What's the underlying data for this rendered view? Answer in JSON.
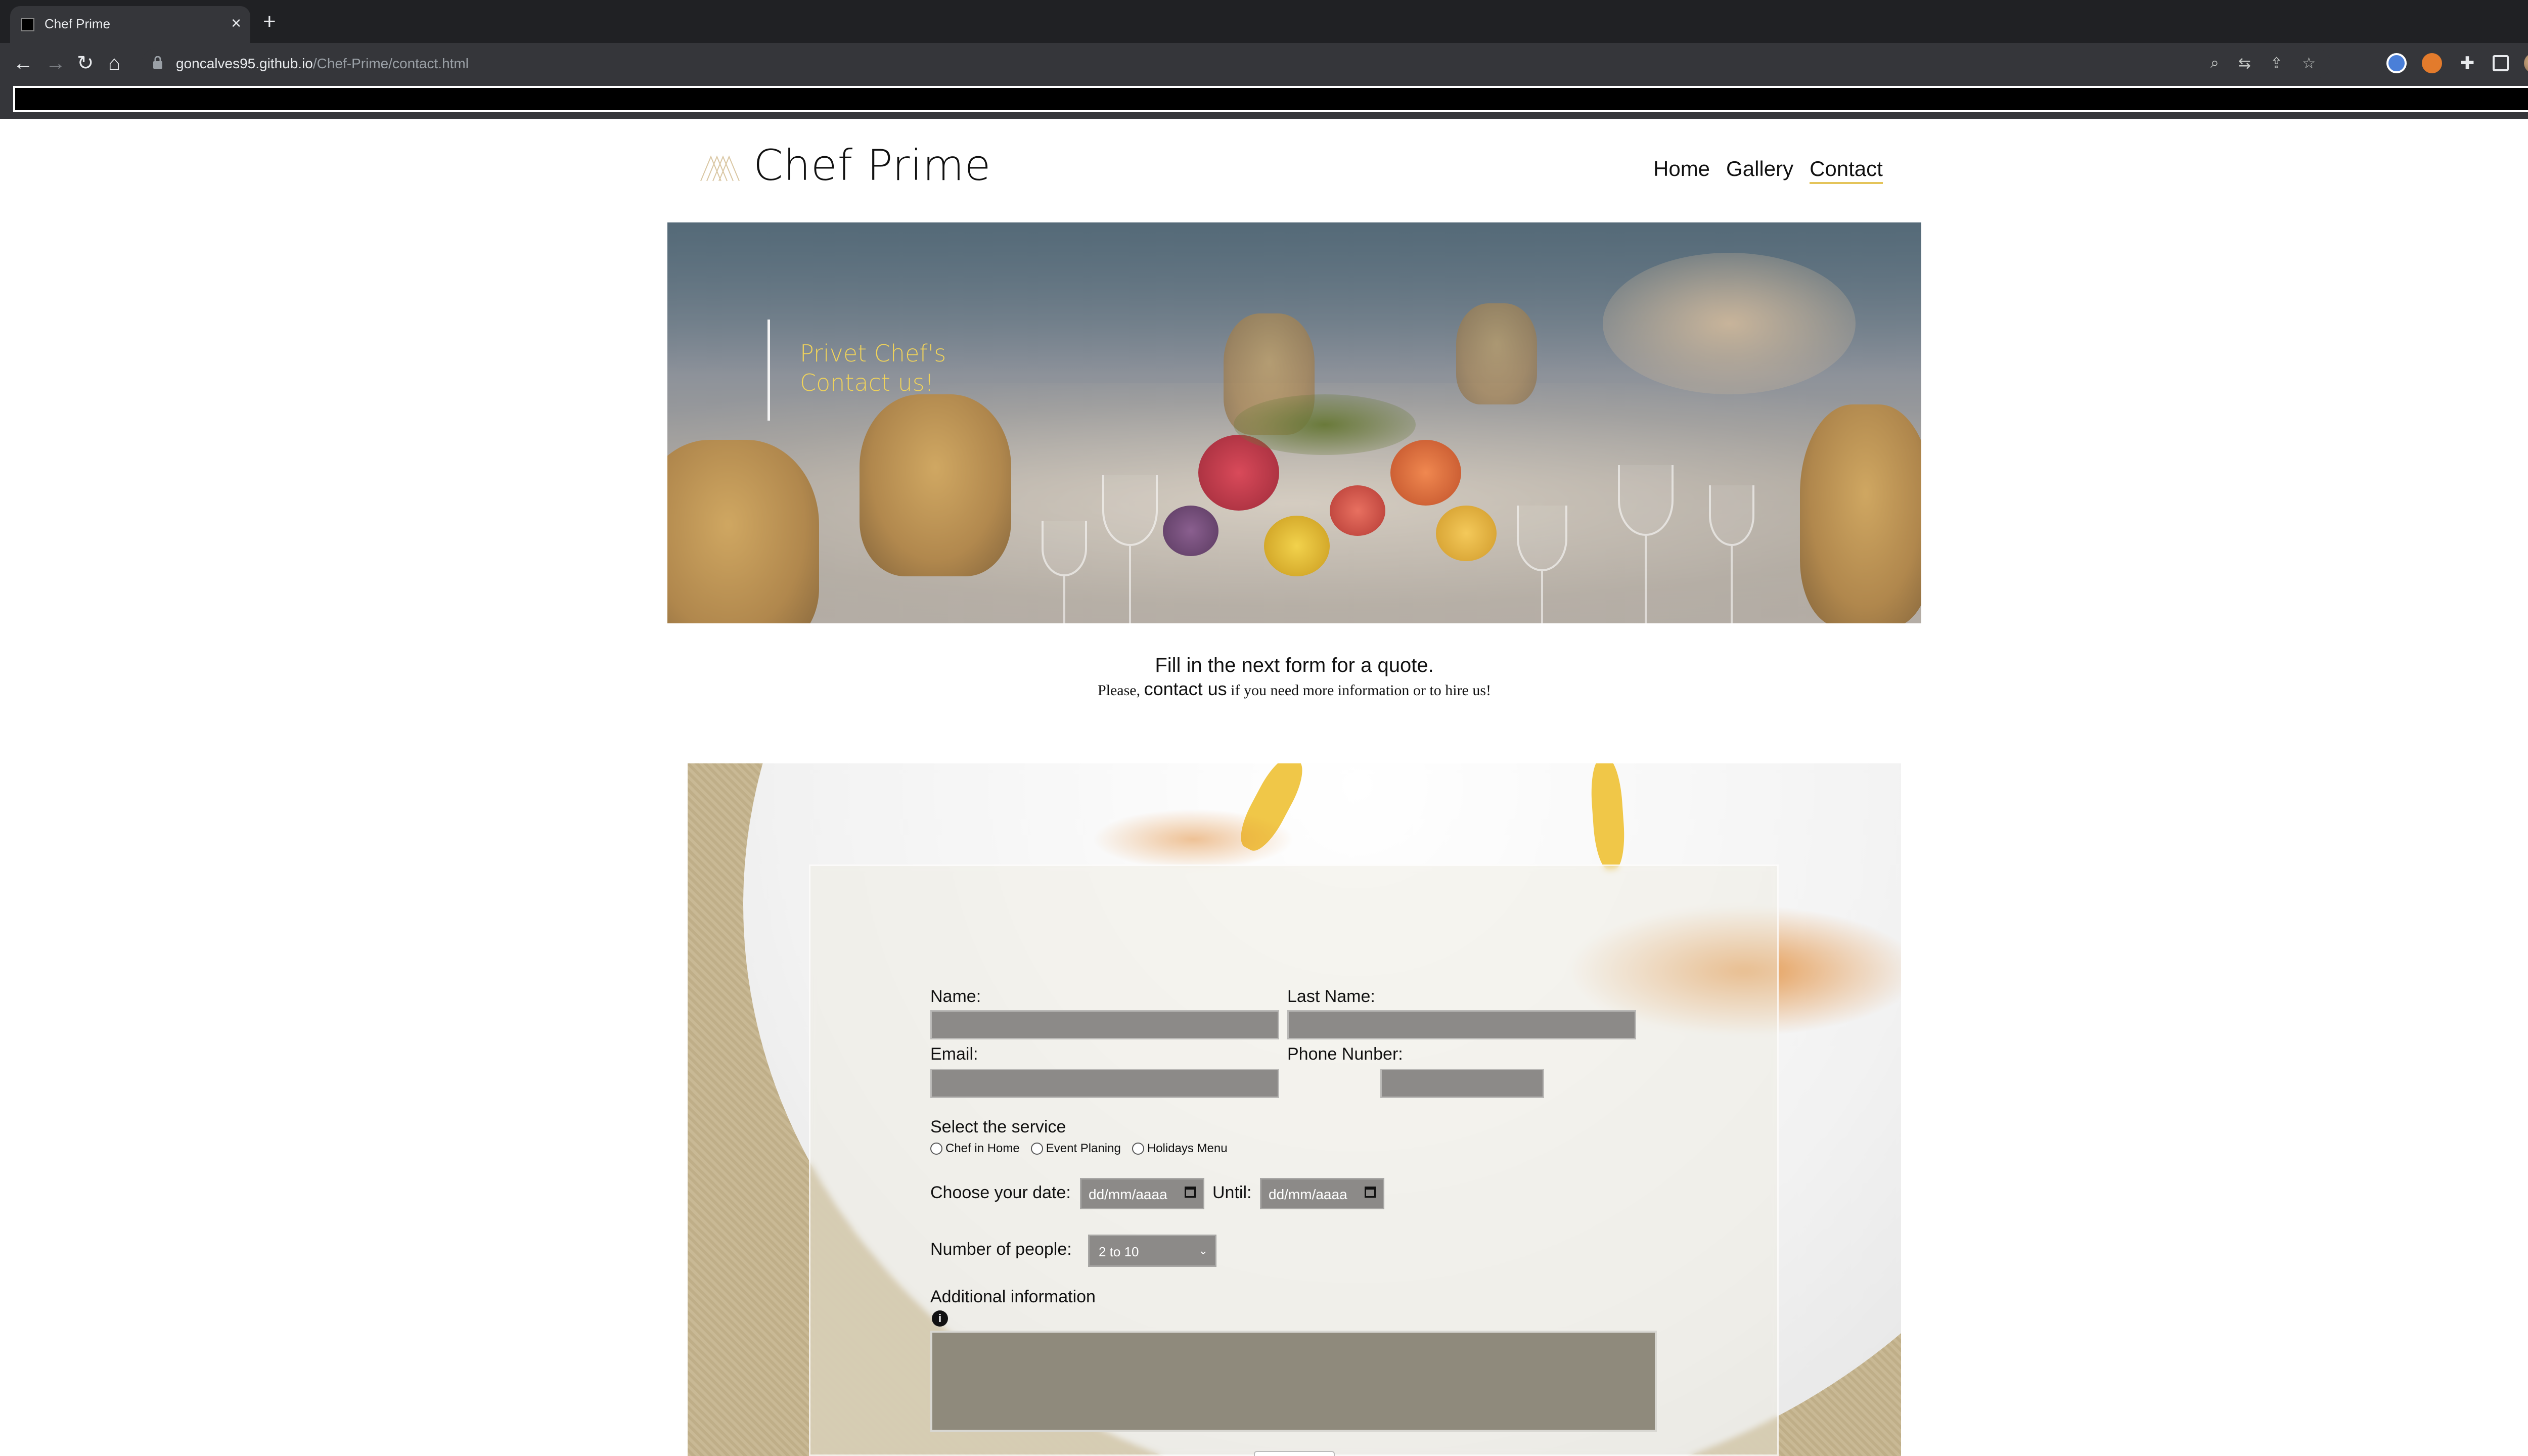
{
  "browser": {
    "tab_title": "Chef Prime",
    "tab_close": "×",
    "new_tab": "+",
    "tab_search": "⌄",
    "back": "←",
    "forward": "→",
    "reload": "↻",
    "home": "⌂",
    "url_host": "goncalves95.github.io",
    "url_path": "/Chef-Prime/contact.html",
    "menu": "⋮"
  },
  "site": {
    "brand": "Chef Prime",
    "nav": [
      {
        "label": "Home",
        "active": false
      },
      {
        "label": "Gallery",
        "active": false
      },
      {
        "label": "Contact",
        "active": true
      }
    ]
  },
  "hero": {
    "line1": "Privet Chef's",
    "line2": "Contact us!"
  },
  "intro": {
    "line1": "Fill in the next form for a quote.",
    "prefix": "Please, ",
    "link": "contact us",
    "suffix": " if you need more information or to hire us!"
  },
  "form": {
    "name_label": "Name:",
    "last_name_label": "Last Name:",
    "email_label": "Email:",
    "phone_label": "Phone Nunber:",
    "service_label": "Select the service",
    "services": [
      "Chef in Home",
      "Event Planing",
      "Holidays Menu"
    ],
    "date_label": "Choose your date:",
    "until_label": "Until:",
    "date_placeholder": "dd/mm/aaaa",
    "people_label": "Number of people:",
    "people_value": "2 to 10",
    "additional_label": "Additional information",
    "info_icon": "i"
  }
}
